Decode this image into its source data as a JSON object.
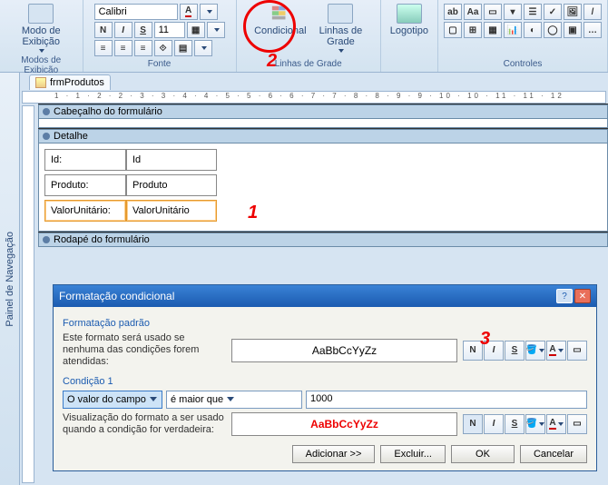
{
  "ribbon": {
    "groups": {
      "modes": {
        "button": "Modo de\nExibição",
        "label": "Modos de Exibição"
      },
      "font": {
        "family": "Calibri",
        "size": "11",
        "b": "N",
        "i": "I",
        "u": "S",
        "label": "Fonte"
      },
      "grid": {
        "conditional": "Condicional",
        "gridlines": "Linhas de\nGrade",
        "label": "Linhas de Grade"
      },
      "logo": {
        "button": "Logotipo"
      },
      "controls": {
        "label": "Controles"
      }
    }
  },
  "tab": {
    "name": "frmProdutos"
  },
  "bands": {
    "header": "Cabeçalho do formulário",
    "detail": "Detalhe",
    "footer": "Rodapé do formulário"
  },
  "fields": {
    "id": {
      "label": "Id:",
      "value": "Id"
    },
    "produto": {
      "label": "Produto:",
      "value": "Produto"
    },
    "valor": {
      "label": "ValorUnitário:",
      "value": "ValorUnitário"
    }
  },
  "annotations": {
    "one": "1",
    "two": "2",
    "three": "3"
  },
  "dialog": {
    "title": "Formatação condicional",
    "section_default": "Formatação padrão",
    "default_desc": "Este formato será usado se nenhuma das condições forem atendidas:",
    "preview_default": "AaBbCcYyZz",
    "section_cond": "Condição 1",
    "field_combo": "O valor do campo",
    "op_combo": "é maior que",
    "value_input": "1000",
    "cond_desc": "Visualização do formato a ser usado quando a condição for verdadeira:",
    "preview_cond": "AaBbCcYyZz",
    "buttons": {
      "add": "Adicionar >>",
      "del": "Excluir...",
      "ok": "OK",
      "cancel": "Cancelar"
    },
    "tools": {
      "b": "N",
      "i": "I",
      "u": "S"
    }
  },
  "nav": {
    "label": "Painel de Navegação"
  },
  "ruler": "1 · 1 · 2 · 2 · 3 · 3 · 4 · 4 · 5 · 5 · 6 · 6 · 7 · 7 · 8 · 8 · 9 · 9 · 10 · 10 · 11 · 11 · 12"
}
